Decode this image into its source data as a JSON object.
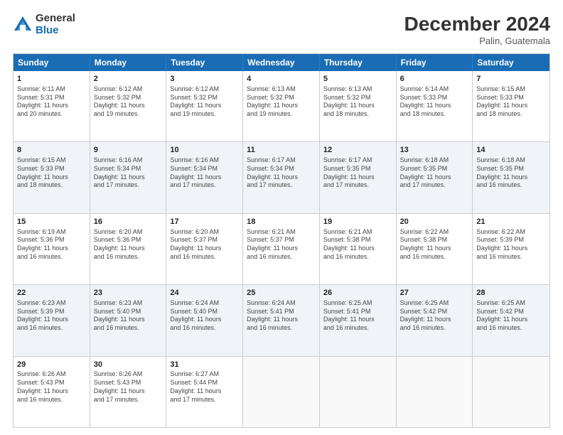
{
  "logo": {
    "general": "General",
    "blue": "Blue"
  },
  "header": {
    "month": "December 2024",
    "location": "Palin, Guatemala"
  },
  "weekdays": [
    "Sunday",
    "Monday",
    "Tuesday",
    "Wednesday",
    "Thursday",
    "Friday",
    "Saturday"
  ],
  "rows": [
    [
      {
        "day": "1",
        "info": "Sunrise: 6:11 AM\nSunset: 5:31 PM\nDaylight: 11 hours\nand 20 minutes."
      },
      {
        "day": "2",
        "info": "Sunrise: 6:12 AM\nSunset: 5:32 PM\nDaylight: 11 hours\nand 19 minutes."
      },
      {
        "day": "3",
        "info": "Sunrise: 6:12 AM\nSunset: 5:32 PM\nDaylight: 11 hours\nand 19 minutes."
      },
      {
        "day": "4",
        "info": "Sunrise: 6:13 AM\nSunset: 5:32 PM\nDaylight: 11 hours\nand 19 minutes."
      },
      {
        "day": "5",
        "info": "Sunrise: 6:13 AM\nSunset: 5:32 PM\nDaylight: 11 hours\nand 18 minutes."
      },
      {
        "day": "6",
        "info": "Sunrise: 6:14 AM\nSunset: 5:33 PM\nDaylight: 11 hours\nand 18 minutes."
      },
      {
        "day": "7",
        "info": "Sunrise: 6:15 AM\nSunset: 5:33 PM\nDaylight: 11 hours\nand 18 minutes."
      }
    ],
    [
      {
        "day": "8",
        "info": "Sunrise: 6:15 AM\nSunset: 5:33 PM\nDaylight: 11 hours\nand 18 minutes."
      },
      {
        "day": "9",
        "info": "Sunrise: 6:16 AM\nSunset: 5:34 PM\nDaylight: 11 hours\nand 17 minutes."
      },
      {
        "day": "10",
        "info": "Sunrise: 6:16 AM\nSunset: 5:34 PM\nDaylight: 11 hours\nand 17 minutes."
      },
      {
        "day": "11",
        "info": "Sunrise: 6:17 AM\nSunset: 5:34 PM\nDaylight: 11 hours\nand 17 minutes."
      },
      {
        "day": "12",
        "info": "Sunrise: 6:17 AM\nSunset: 5:35 PM\nDaylight: 11 hours\nand 17 minutes."
      },
      {
        "day": "13",
        "info": "Sunrise: 6:18 AM\nSunset: 5:35 PM\nDaylight: 11 hours\nand 17 minutes."
      },
      {
        "day": "14",
        "info": "Sunrise: 6:18 AM\nSunset: 5:35 PM\nDaylight: 11 hours\nand 16 minutes."
      }
    ],
    [
      {
        "day": "15",
        "info": "Sunrise: 6:19 AM\nSunset: 5:36 PM\nDaylight: 11 hours\nand 16 minutes."
      },
      {
        "day": "16",
        "info": "Sunrise: 6:20 AM\nSunset: 5:36 PM\nDaylight: 11 hours\nand 16 minutes."
      },
      {
        "day": "17",
        "info": "Sunrise: 6:20 AM\nSunset: 5:37 PM\nDaylight: 11 hours\nand 16 minutes."
      },
      {
        "day": "18",
        "info": "Sunrise: 6:21 AM\nSunset: 5:37 PM\nDaylight: 11 hours\nand 16 minutes."
      },
      {
        "day": "19",
        "info": "Sunrise: 6:21 AM\nSunset: 5:38 PM\nDaylight: 11 hours\nand 16 minutes."
      },
      {
        "day": "20",
        "info": "Sunrise: 6:22 AM\nSunset: 5:38 PM\nDaylight: 11 hours\nand 16 minutes."
      },
      {
        "day": "21",
        "info": "Sunrise: 6:22 AM\nSunset: 5:39 PM\nDaylight: 11 hours\nand 16 minutes."
      }
    ],
    [
      {
        "day": "22",
        "info": "Sunrise: 6:23 AM\nSunset: 5:39 PM\nDaylight: 11 hours\nand 16 minutes."
      },
      {
        "day": "23",
        "info": "Sunrise: 6:23 AM\nSunset: 5:40 PM\nDaylight: 11 hours\nand 16 minutes."
      },
      {
        "day": "24",
        "info": "Sunrise: 6:24 AM\nSunset: 5:40 PM\nDaylight: 11 hours\nand 16 minutes."
      },
      {
        "day": "25",
        "info": "Sunrise: 6:24 AM\nSunset: 5:41 PM\nDaylight: 11 hours\nand 16 minutes."
      },
      {
        "day": "26",
        "info": "Sunrise: 6:25 AM\nSunset: 5:41 PM\nDaylight: 11 hours\nand 16 minutes."
      },
      {
        "day": "27",
        "info": "Sunrise: 6:25 AM\nSunset: 5:42 PM\nDaylight: 11 hours\nand 16 minutes."
      },
      {
        "day": "28",
        "info": "Sunrise: 6:25 AM\nSunset: 5:42 PM\nDaylight: 11 hours\nand 16 minutes."
      }
    ],
    [
      {
        "day": "29",
        "info": "Sunrise: 6:26 AM\nSunset: 5:43 PM\nDaylight: 11 hours\nand 16 minutes."
      },
      {
        "day": "30",
        "info": "Sunrise: 6:26 AM\nSunset: 5:43 PM\nDaylight: 11 hours\nand 17 minutes."
      },
      {
        "day": "31",
        "info": "Sunrise: 6:27 AM\nSunset: 5:44 PM\nDaylight: 11 hours\nand 17 minutes."
      },
      {
        "day": "",
        "info": ""
      },
      {
        "day": "",
        "info": ""
      },
      {
        "day": "",
        "info": ""
      },
      {
        "day": "",
        "info": ""
      }
    ]
  ]
}
